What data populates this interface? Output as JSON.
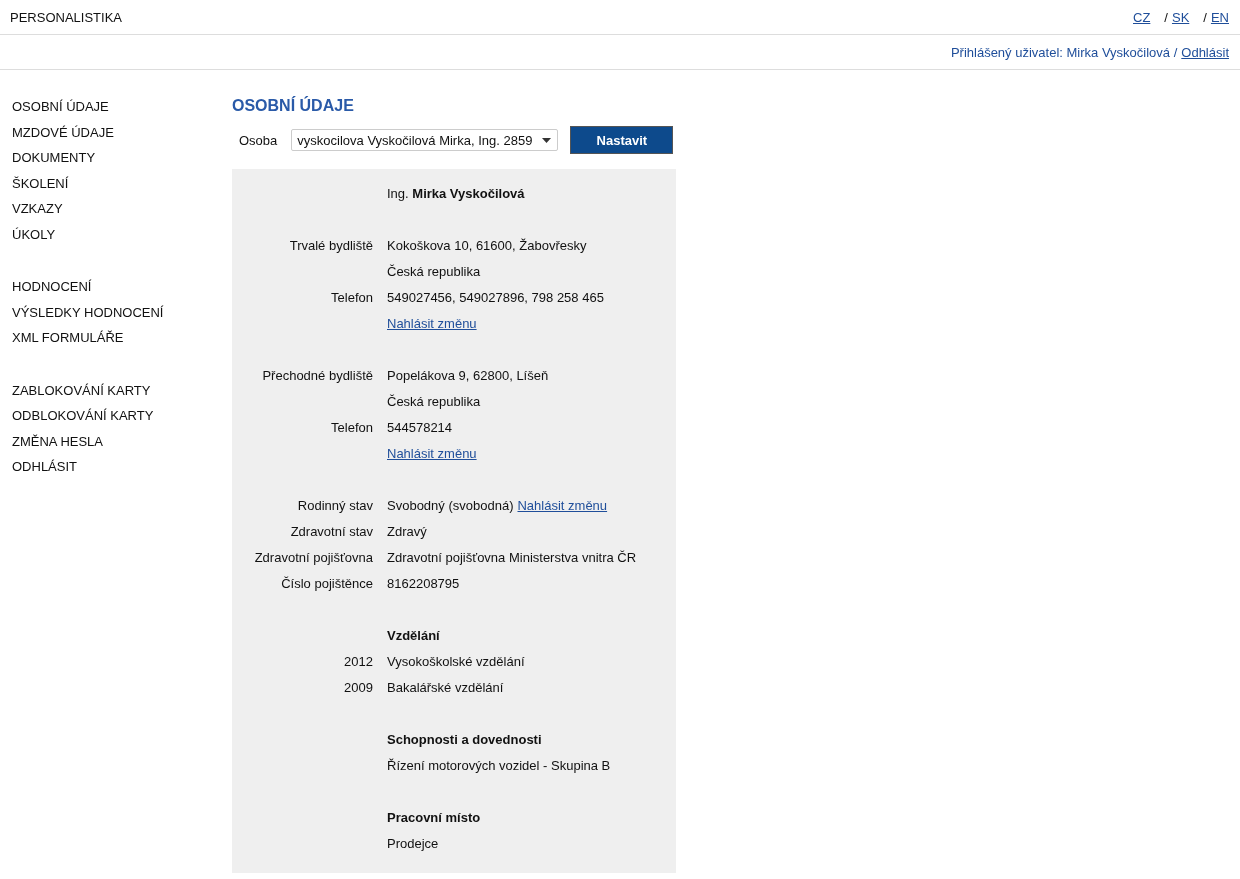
{
  "header": {
    "app_name": "PERSONALISTIKA",
    "languages": [
      {
        "label": "CZ"
      },
      {
        "separator": "/",
        "label": "SK"
      },
      {
        "separator": "/",
        "label": "EN"
      }
    ]
  },
  "user_bar": {
    "text": "Přihlášený uživatel: Mirka Vyskočilová /",
    "logout": "Odhlásit"
  },
  "sidebar": {
    "groups": [
      [
        "OSOBNÍ ÚDAJE",
        "MZDOVÉ ÚDAJE",
        "DOKUMENTY",
        "ŠKOLENÍ",
        "VZKAZY",
        "ÚKOLY"
      ],
      [
        "HODNOCENÍ",
        "VÝSLEDKY HODNOCENÍ",
        "XML FORMULÁŘE"
      ],
      [
        "ZABLOKOVÁNÍ KARTY",
        "ODBLOKOVÁNÍ KARTY",
        "ZMĚNA HESLA",
        "ODHLÁSIT"
      ]
    ]
  },
  "page_title": "OSOBNÍ ÚDAJE",
  "person_select": {
    "label": "Osoba",
    "value": "vyskocilova Vyskočilová Mirka, Ing. 2859",
    "button": "Nastavit"
  },
  "sections": [
    [
      {
        "kind": "name",
        "value": "Ing. **Mirka Vyskočilová**"
      }
    ],
    [
      {
        "kind": "field",
        "label": "Trvalé bydliště",
        "value": "Kokoškova 10, 61600, Žabovřesky"
      },
      {
        "kind": "field",
        "value": "Česká republika"
      },
      {
        "kind": "field",
        "label": "Telefon",
        "value": "549027456, 549027896, 798 258 465"
      },
      {
        "kind": "field",
        "link": "Nahlásit změnu"
      }
    ],
    [
      {
        "kind": "field",
        "label": "Přechodné bydliště",
        "value": "Popelákova 9, 62800, Líšeň"
      },
      {
        "kind": "field",
        "value": "Česká republika"
      },
      {
        "kind": "field",
        "label": "Telefon",
        "value": "544578214"
      },
      {
        "kind": "field",
        "link": "Nahlásit změnu"
      }
    ],
    [
      {
        "kind": "field",
        "label": "Rodinný stav",
        "value": "Svobodný (svobodná)",
        "link": "Nahlásit změnu"
      },
      {
        "kind": "field",
        "label": "Zdravotní stav",
        "value": "Zdravý"
      },
      {
        "kind": "field",
        "label": "Zdravotní pojišťovna",
        "value": "Zdravotní pojišťovna Ministerstva vnitra ČR"
      },
      {
        "kind": "field",
        "label": "Číslo pojištěnce",
        "value": "8162208795"
      }
    ],
    [
      {
        "kind": "heading",
        "value": "Vzdělání"
      },
      {
        "kind": "field",
        "label": "2012",
        "value": "Vysokoškolské vzdělání"
      },
      {
        "kind": "field",
        "label": "2009",
        "value": "Bakalářské vzdělání"
      }
    ],
    [
      {
        "kind": "heading",
        "value": "Schopnosti a dovednosti"
      },
      {
        "kind": "field",
        "value": "Řízení motorových vozidel - Skupina B"
      }
    ],
    [
      {
        "kind": "heading",
        "value": "Pracovní místo"
      },
      {
        "kind": "field",
        "value": "Prodejce"
      }
    ]
  ]
}
